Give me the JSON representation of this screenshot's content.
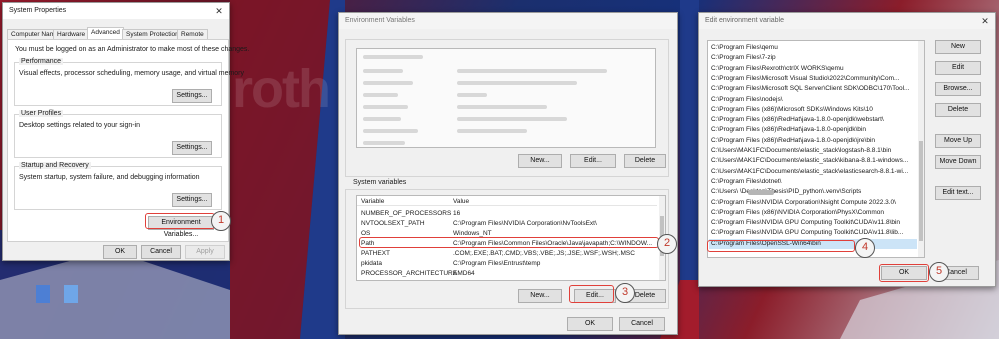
{
  "desktop": {
    "watermark": "roth"
  },
  "sysprops": {
    "title": "System Properties",
    "tabs": [
      "Computer Name",
      "Hardware",
      "Advanced",
      "System Protection",
      "Remote"
    ],
    "admin_note": "You must be logged on as an Administrator to make most of these changes.",
    "performance": {
      "title": "Performance",
      "desc": "Visual effects, processor scheduling, memory usage, and virtual memory",
      "settings": "Settings..."
    },
    "user_profiles": {
      "title": "User Profiles",
      "desc": "Desktop settings related to your sign-in",
      "settings": "Settings..."
    },
    "startup": {
      "title": "Startup and Recovery",
      "desc": "System startup, system failure, and debugging information",
      "settings": "Settings..."
    },
    "env_button": "Environment Variables...",
    "ok": "OK",
    "cancel": "Cancel",
    "apply": "Apply"
  },
  "envvars": {
    "title": "Environment Variables",
    "user_buttons": {
      "new": "New...",
      "edit": "Edit...",
      "delete": "Delete"
    },
    "system_title": "System variables",
    "col_variable": "Variable",
    "col_value": "Value",
    "system_rows": [
      {
        "name": "NUMBER_OF_PROCESSORS",
        "value": "16"
      },
      {
        "name": "NVTOOLSEXT_PATH",
        "value": "C:\\Program Files\\NVIDIA Corporation\\NvToolsExt\\"
      },
      {
        "name": "OS",
        "value": "Windows_NT"
      },
      {
        "name": "Path",
        "value": "C:\\Program Files\\Common Files\\Oracle\\Java\\javapath;C:\\WINDOW..."
      },
      {
        "name": "PATHEXT",
        "value": ".COM;.EXE;.BAT;.CMD;.VBS;.VBE;.JS;.JSE;.WSF;.WSH;.MSC"
      },
      {
        "name": "pkidata",
        "value": "C:\\Program Files\\Entrust\\temp"
      },
      {
        "name": "PROCESSOR_ARCHITECTURE",
        "value": "AMD64"
      }
    ],
    "system_buttons": {
      "new": "New...",
      "edit": "Edit...",
      "delete": "Delete"
    },
    "ok": "OK",
    "cancel": "Cancel"
  },
  "editvar": {
    "title": "Edit environment variable",
    "entries": [
      "C:\\Program Files\\qemu",
      "C:\\Program Files\\7-zip",
      "C:\\Program Files\\Rexroth\\ctrlX WORKS\\qemu",
      "C:\\Program Files\\Microsoft Visual Studio\\2022\\Community\\Com...",
      "C:\\Program Files\\Microsoft SQL Server\\Client SDK\\ODBC\\170\\Tool...",
      "C:\\Program Files\\nodejs\\",
      "C:\\Program Files (x86)\\Microsoft SDKs\\Windows Kits\\10",
      "C:\\Program Files (x86)\\RedHat\\java-1.8.0-openjdk\\webstart\\",
      "C:\\Program Files (x86)\\RedHat\\java-1.8.0-openjdk\\bin",
      "C:\\Program Files (x86)\\RedHat\\java-1.8.0-openjdk\\jre\\bin",
      "C:\\Users\\MAK1FC\\Documents\\elastic_stack\\logstash-8.8.1\\bin",
      "C:\\Users\\MAK1FC\\Documents\\elastic_stack\\kibana-8.8.1-windows...",
      "C:\\Users\\MAK1FC\\Documents\\elastic_stack\\elasticsearch-8.8.1-wi...",
      "C:\\Program Files\\dotnet\\",
      "C:\\Users\\          \\Desktop\\Thesis\\PID_python\\.venv\\Scripts",
      "C:\\Program Files\\NVIDIA Corporation\\Nsight Compute 2022.3.0\\",
      "C:\\Program Files (x86)\\NVIDIA Corporation\\PhysX\\Common",
      "C:\\Program Files\\NVIDIA GPU Computing Toolkit\\CUDA\\v11.8\\bin",
      "C:\\Program Files\\NVIDIA GPU Computing Toolkit\\CUDA\\v11.8\\lib...",
      "C:\\Program Files\\OpenSSL-Win64\\bin"
    ],
    "buttons": {
      "new": "New",
      "edit": "Edit",
      "browse": "Browse...",
      "delete": "Delete",
      "move_up": "Move Up",
      "move_down": "Move Down",
      "edit_text": "Edit text..."
    },
    "ok": "OK",
    "cancel": "Cancel"
  },
  "steps": [
    "1",
    "2",
    "3",
    "4",
    "5"
  ],
  "colors": {
    "highlight": "#e0403a",
    "selection": "#cce4f7",
    "step_text": "#c0392b"
  }
}
